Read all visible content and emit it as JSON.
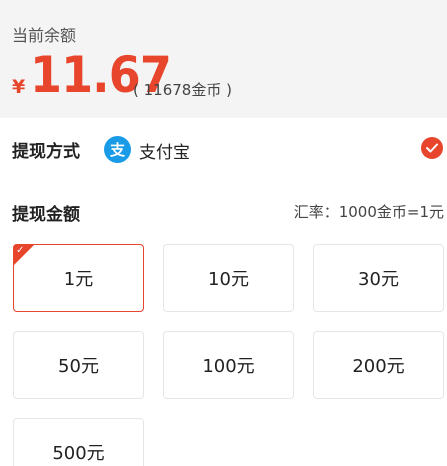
{
  "balance": {
    "label": "当前余额",
    "currency_symbol": "¥",
    "amount": "11.67",
    "coins": "( 11678金币 )"
  },
  "withdraw_method": {
    "title": "提现方式",
    "method_icon": "alipay-icon",
    "method_icon_glyph": "支",
    "method_label": "支付宝",
    "selected_icon": "check-circle-icon"
  },
  "withdraw_amount": {
    "title": "提现金额",
    "rate": "汇率：1000金币=1元",
    "selected_index": 0,
    "options": [
      "1元",
      "10元",
      "30元",
      "50元",
      "100元",
      "200元",
      "500元"
    ]
  },
  "colors": {
    "accent": "#e8452d",
    "alipay": "#1a9be8",
    "header_bg": "#f4f4f4"
  }
}
